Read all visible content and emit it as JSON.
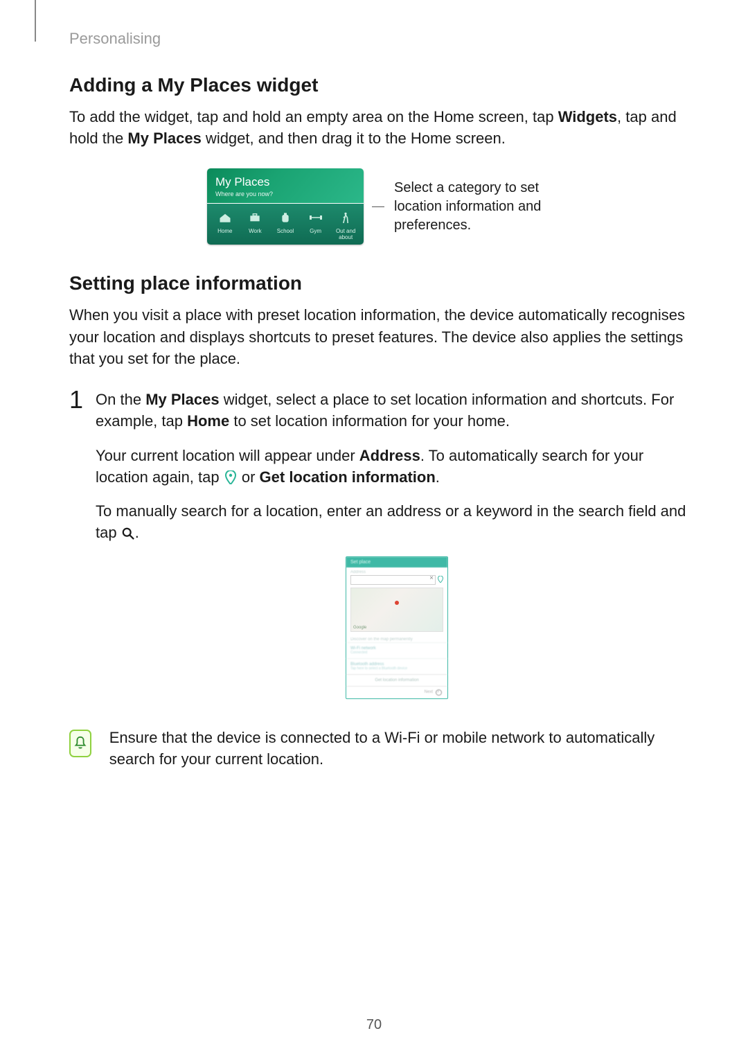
{
  "meta": {
    "page_number": "70"
  },
  "header": {
    "section": "Personalising"
  },
  "section1": {
    "heading": "Adding a My Places widget",
    "para_parts": [
      "To add the widget, tap and hold an empty area on the Home screen, tap ",
      "Widgets",
      ", tap and hold the ",
      "My Places",
      " widget, and then drag it to the Home screen."
    ]
  },
  "widget": {
    "title": "My Places",
    "subtitle": "Where are you now?",
    "categories": [
      {
        "label": "Home"
      },
      {
        "label": "Work"
      },
      {
        "label": "School"
      },
      {
        "label": "Gym"
      },
      {
        "label": "Out and about"
      }
    ]
  },
  "callout": {
    "text": "Select a category to set location information and preferences."
  },
  "section2": {
    "heading": "Setting place information",
    "intro": "When you visit a place with preset location information, the device automatically recognises your location and displays shortcuts to preset features. The device also applies the settings that you set for the place."
  },
  "step1": {
    "number": "1",
    "p1_parts": [
      "On the ",
      "My Places",
      " widget, select a place to set location information and shortcuts. For example, tap ",
      "Home",
      " to set location information for your home."
    ],
    "p2_parts": [
      "Your current location will appear under ",
      "Address",
      ". To automatically search for your location again, tap ",
      " or ",
      "Get location information",
      "."
    ],
    "p3_parts": [
      "To manually search for a location, enter an address or a keyword in the search field and tap ",
      "."
    ]
  },
  "phone": {
    "map_brand": "Google"
  },
  "note": {
    "text": "Ensure that the device is connected to a Wi-Fi or mobile network to automatically search for your current location."
  }
}
